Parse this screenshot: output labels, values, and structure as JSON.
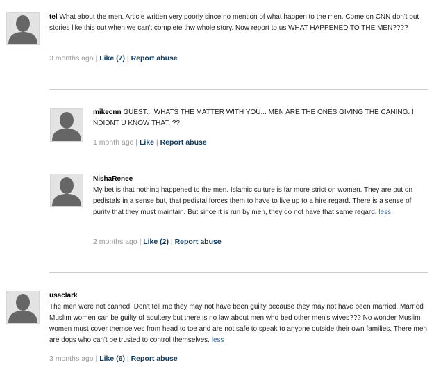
{
  "comments": [
    {
      "username": "tel",
      "text": " What about the men. Article written very poorly since no mention of what happen to the men. Come on CNN don't put stories like this out when we can't complete thw whole story. Now report to us WHAT HAPPENED TO THE MEN????",
      "time": "3 months ago",
      "like": "Like (7)",
      "report": "Report abuse"
    },
    {
      "username": "mikecnn",
      "text": " GUEST... WHATS THE MATTER WITH YOU... MEN ARE THE ONES GIVING THE CANING. ! NDIDNT U KNOW THAT. ??",
      "time": "1 month ago",
      "like": "Like",
      "report": "Report abuse"
    },
    {
      "username": "NishaRenee",
      "text": "My bet is that nothing happened to the men. Islamic culture is far more strict on women. They are put on pedistals in a sense but, that pedistal forces them to have to live up to a hire regard. There is a sense of purity that they must maintain. But since it is run by men, they do not have that same regard.",
      "more": "less",
      "time": "2 months ago",
      "like": "Like (2)",
      "report": "Report abuse"
    },
    {
      "username": "usaclark",
      "text": "The men were not canned. Don't tell me they may not have been guilty because they may not have been married. Married Muslim women can be guilty of adultery but there is no law about men who bed other men's wives??? No wonder Muslim women must cover themselves from head to toe and are not safe to speak to anyone outside their own families. There men are dogs who can't be trusted to control themselves.",
      "more": "less",
      "time": "3 months ago",
      "like": "Like (6)",
      "report": "Report abuse"
    }
  ],
  "separator": "|"
}
